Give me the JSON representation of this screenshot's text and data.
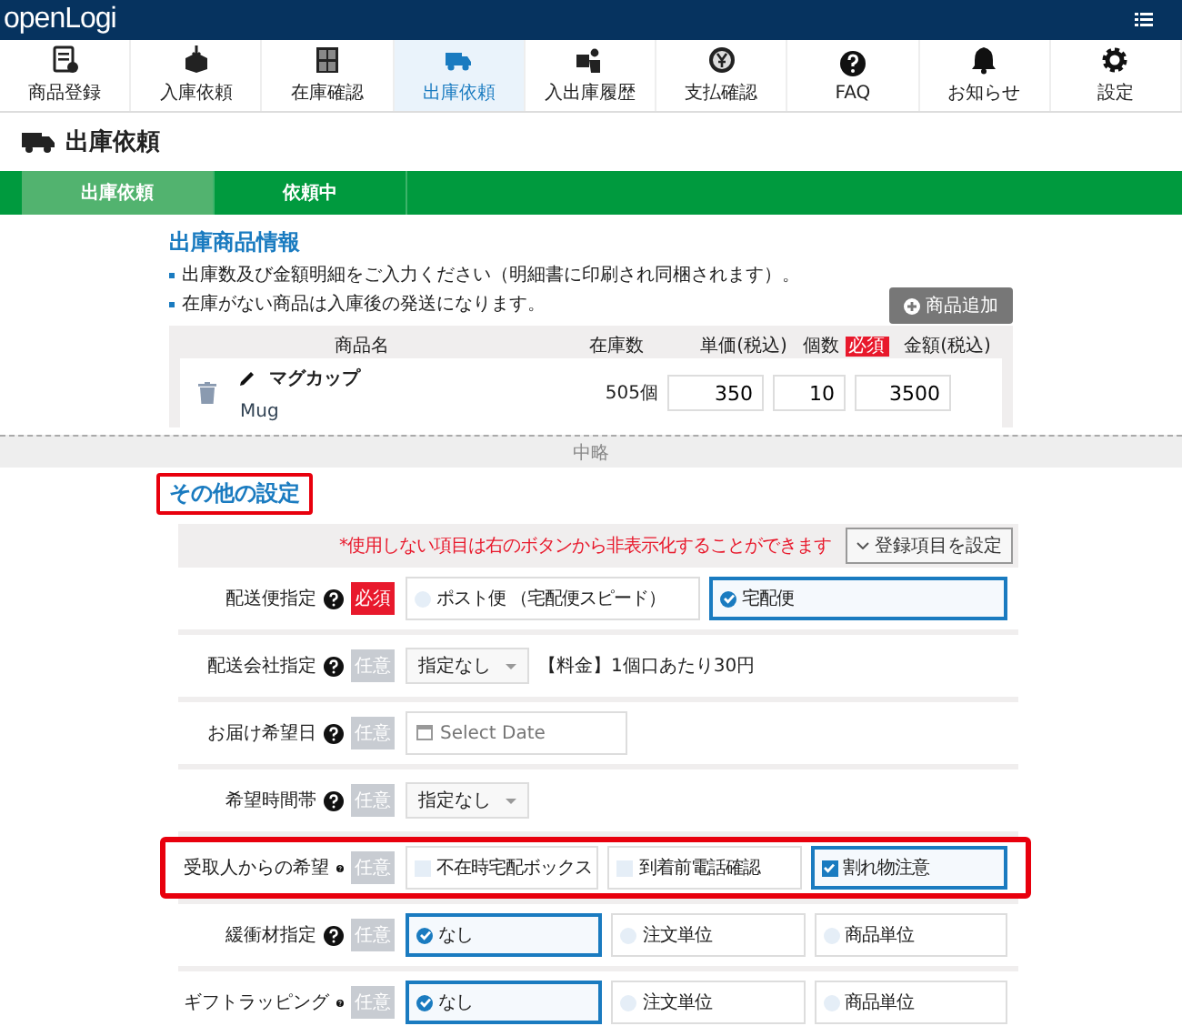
{
  "header": {
    "logo": "openLogi"
  },
  "nav": [
    {
      "label": "商品登録",
      "selected": false
    },
    {
      "label": "入庫依頼",
      "selected": false
    },
    {
      "label": "在庫確認",
      "selected": false
    },
    {
      "label": "出庫依頼",
      "selected": true
    },
    {
      "label": "入出庫履歴",
      "selected": false
    },
    {
      "label": "支払確認",
      "selected": false
    },
    {
      "label": "FAQ",
      "selected": false
    },
    {
      "label": "お知らせ",
      "selected": false
    },
    {
      "label": "設定",
      "selected": false
    }
  ],
  "page_title": "出庫依頼",
  "steps": [
    {
      "label": "出庫依頼",
      "selected": true
    },
    {
      "label": "依頼中",
      "selected": false
    }
  ],
  "products": {
    "title": "出庫商品情報",
    "notes": [
      "出庫数及び金額明細をご入力ください（明細書に印刷され同梱されます）。",
      "在庫がない商品は入庫後の発送になります。"
    ],
    "add_button": "商品追加",
    "columns": [
      {
        "label": "商品名"
      },
      {
        "label": "在庫数"
      },
      {
        "label": "単価(税込)"
      },
      {
        "label": "個数",
        "tag": "必須"
      },
      {
        "label": "金額(税込)"
      }
    ],
    "rows": [
      {
        "name": "マグカップ",
        "sub": "Mug",
        "stock": "505個",
        "price": "350",
        "qty": "10",
        "amount": "3500"
      }
    ]
  },
  "omitted": "中略",
  "other": {
    "title": "その他の設定",
    "highlighted": true,
    "hint": "*使用しない項目は右のボタンから非表示化することができます",
    "config_button": "登録項目を設定",
    "rows": [
      {
        "label": "配送便指定",
        "required": true,
        "tag": "必須",
        "kind": "radio",
        "highlighted": false,
        "options": [
          {
            "label": "ポスト便 （宅配便スピード）",
            "selected": false
          },
          {
            "label": "宅配便",
            "selected": true
          }
        ]
      },
      {
        "label": "配送会社指定",
        "required": false,
        "tag": "任意",
        "kind": "select",
        "highlighted": false,
        "value": "指定なし",
        "note": "【料金】1個口あたり30円"
      },
      {
        "label": "お届け希望日",
        "required": false,
        "tag": "任意",
        "kind": "date",
        "highlighted": false,
        "placeholder": "Select Date"
      },
      {
        "label": "希望時間帯",
        "required": false,
        "tag": "任意",
        "kind": "select",
        "highlighted": false,
        "value": "指定なし"
      },
      {
        "label": "受取人からの希望",
        "required": false,
        "tag": "任意",
        "kind": "check",
        "highlighted": true,
        "options": [
          {
            "label": "不在時宅配ボックス",
            "checked": false
          },
          {
            "label": "到着前電話確認",
            "checked": false
          },
          {
            "label": "割れ物注意",
            "checked": true
          }
        ]
      },
      {
        "label": "緩衝材指定",
        "required": false,
        "tag": "任意",
        "kind": "radio",
        "highlighted": false,
        "options": [
          {
            "label": "なし",
            "selected": true
          },
          {
            "label": "注文単位",
            "selected": false
          },
          {
            "label": "商品単位",
            "selected": false
          }
        ]
      },
      {
        "label": "ギフトラッピング",
        "required": false,
        "tag": "任意",
        "kind": "radio",
        "highlighted": false,
        "options": [
          {
            "label": "なし",
            "selected": true
          },
          {
            "label": "注文単位",
            "selected": false
          },
          {
            "label": "商品単位",
            "selected": false
          }
        ]
      }
    ]
  }
}
